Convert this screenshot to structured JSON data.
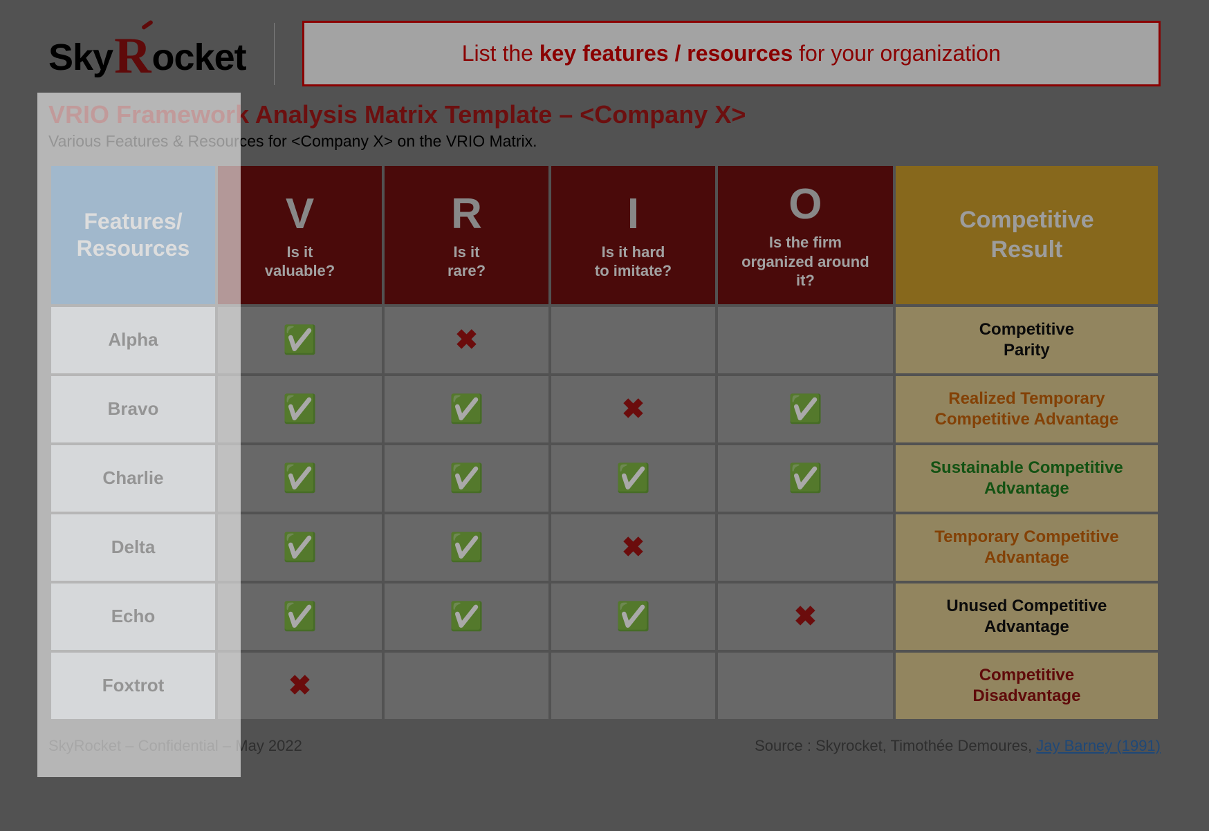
{
  "logo": {
    "pre": "Sky",
    "r": "R",
    "post": "ocket"
  },
  "callout": {
    "pre": "List the ",
    "bold": "key features / resources",
    "post": " for your organization"
  },
  "title": "VRIO Framework Analysis Matrix Template – <Company X>",
  "subtitle": "Various Features & Resources for <Company X> on the VRIO Matrix.",
  "headers": {
    "features": "Features/\nResources",
    "v": {
      "letter": "V",
      "sub": "Is it\nvaluable?"
    },
    "r": {
      "letter": "R",
      "sub": "Is it\nrare?"
    },
    "i": {
      "letter": "I",
      "sub": "Is it hard\nto imitate?"
    },
    "o": {
      "letter": "O",
      "sub": "Is the firm\norganized around\nit?"
    },
    "result": "Competitive\nResult"
  },
  "rows": [
    {
      "name": "Alpha",
      "v": "check",
      "r": "cross",
      "i": "",
      "o": "",
      "result": "Competitive\nParity",
      "result_color": "black"
    },
    {
      "name": "Bravo",
      "v": "check",
      "r": "check",
      "i": "cross",
      "o": "check",
      "result": "Realized Temporary\nCompetitive Advantage",
      "result_color": "orange"
    },
    {
      "name": "Charlie",
      "v": "check",
      "r": "check",
      "i": "check",
      "o": "check",
      "result": "Sustainable Competitive\nAdvantage",
      "result_color": "green"
    },
    {
      "name": "Delta",
      "v": "check",
      "r": "check",
      "i": "cross",
      "o": "",
      "result": "Temporary Competitive\nAdvantage",
      "result_color": "orange"
    },
    {
      "name": "Echo",
      "v": "check",
      "r": "check",
      "i": "check",
      "o": "cross",
      "result": "Unused Competitive\nAdvantage",
      "result_color": "black"
    },
    {
      "name": "Foxtrot",
      "v": "cross",
      "r": "",
      "i": "",
      "o": "",
      "result": "Competitive\nDisadvantage",
      "result_color": "red"
    }
  ],
  "footer": {
    "left": "SkyRocket – Confidential – May 2022",
    "right_pre": "Source : Skyrocket, Timothée Demoures,  ",
    "right_link": "Jay Barney (1991)"
  },
  "chart_data": {
    "type": "table",
    "title": "VRIO Framework Analysis Matrix Template – <Company X>",
    "columns": [
      "Features/Resources",
      "V (valuable?)",
      "R (rare?)",
      "I (hard to imitate?)",
      "O (organized around it?)",
      "Competitive Result"
    ],
    "rows": [
      [
        "Alpha",
        true,
        false,
        null,
        null,
        "Competitive Parity"
      ],
      [
        "Bravo",
        true,
        true,
        false,
        true,
        "Realized Temporary Competitive Advantage"
      ],
      [
        "Charlie",
        true,
        true,
        true,
        true,
        "Sustainable Competitive Advantage"
      ],
      [
        "Delta",
        true,
        true,
        false,
        null,
        "Temporary Competitive Advantage"
      ],
      [
        "Echo",
        true,
        true,
        true,
        false,
        "Unused Competitive Advantage"
      ],
      [
        "Foxtrot",
        false,
        null,
        null,
        null,
        "Competitive Disadvantage"
      ]
    ]
  }
}
